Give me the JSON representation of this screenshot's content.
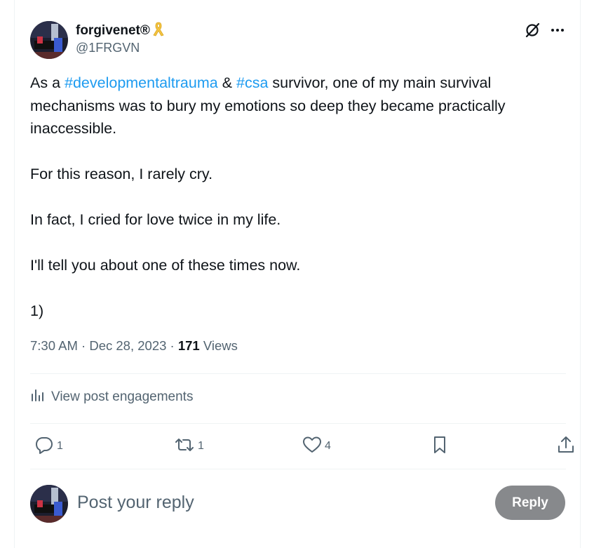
{
  "author": {
    "display_name": "forgivenet®",
    "badge_icon": "yellow-ribbon-icon",
    "handle": "@1FRGVN"
  },
  "header_icons": [
    "grok-icon",
    "more-icon"
  ],
  "tweet": {
    "paragraph_1": {
      "part_1": "As a ",
      "hashtag_1": "#developmentaltrauma",
      "part_2": " & ",
      "hashtag_2": "#csa",
      "part_3": " survivor, one of my main survival mechanisms was to bury my emotions so deep they became practically inaccessible."
    },
    "paragraph_2": "For this reason, I rarely cry.",
    "paragraph_3": "In fact, I cried for love twice in my life.",
    "paragraph_4": "I'll tell you about one of these times now.",
    "paragraph_5": "1)"
  },
  "meta": {
    "time": "7:30 AM",
    "separator": " · ",
    "date": "Dec 28, 2023",
    "views_count": "171",
    "views_label": " Views"
  },
  "engagements": {
    "icon": "analytics-icon",
    "label": "View post engagements"
  },
  "actions": {
    "reply_count": "1",
    "repost_count": "1",
    "like_count": "4",
    "icons": [
      "reply-icon",
      "repost-icon",
      "like-icon",
      "bookmark-icon",
      "share-icon"
    ]
  },
  "reply_box": {
    "placeholder": "Post your reply",
    "button_label": "Reply"
  },
  "colors": {
    "link": "#1d9bf0",
    "secondary_text": "#536471",
    "primary_text": "#0f1419",
    "reply_button_bg": "#87898c",
    "divider": "#eff3f4",
    "ribbon": "#f5c542"
  }
}
